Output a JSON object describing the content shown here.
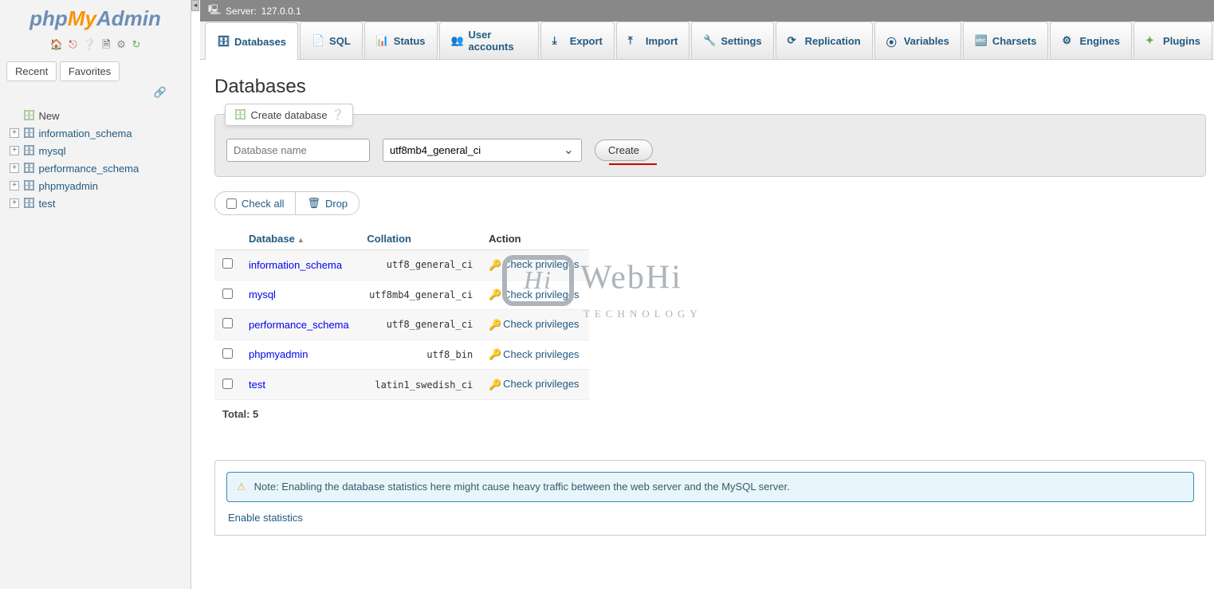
{
  "logo": {
    "php": "php",
    "my": "My",
    "admin": "Admin"
  },
  "sidebar": {
    "tabs": {
      "recent": "Recent",
      "favorites": "Favorites"
    },
    "new_label": "New",
    "databases": [
      "information_schema",
      "mysql",
      "performance_schema",
      "phpmyadmin",
      "test"
    ]
  },
  "serverinfo": {
    "label": "Server:",
    "host": "127.0.0.1"
  },
  "tabs": [
    {
      "label": "Databases",
      "active": true
    },
    {
      "label": "SQL"
    },
    {
      "label": "Status"
    },
    {
      "label": "User accounts"
    },
    {
      "label": "Export"
    },
    {
      "label": "Import"
    },
    {
      "label": "Settings"
    },
    {
      "label": "Replication"
    },
    {
      "label": "Variables"
    },
    {
      "label": "Charsets"
    },
    {
      "label": "Engines"
    },
    {
      "label": "Plugins"
    }
  ],
  "page": {
    "title": "Databases"
  },
  "create": {
    "legend": "Create database",
    "placeholder": "Database name",
    "collation": "utf8mb4_general_ci",
    "button": "Create"
  },
  "bulk": {
    "check_all": "Check all",
    "drop": "Drop"
  },
  "table": {
    "headers": {
      "database": "Database",
      "collation": "Collation",
      "action": "Action"
    },
    "priv_label": "Check privileges",
    "rows": [
      {
        "name": "information_schema",
        "collation": "utf8_general_ci"
      },
      {
        "name": "mysql",
        "collation": "utf8mb4_general_ci"
      },
      {
        "name": "performance_schema",
        "collation": "utf8_general_ci"
      },
      {
        "name": "phpmyadmin",
        "collation": "utf8_bin"
      },
      {
        "name": "test",
        "collation": "latin1_swedish_ci"
      }
    ],
    "total_label": "Total:",
    "total_count": "5"
  },
  "notice": {
    "text": "Note: Enabling the database statistics here might cause heavy traffic between the web server and the MySQL server.",
    "enable": "Enable statistics"
  },
  "watermark": {
    "top": "WebHi",
    "sub": "TECHNOLOGY",
    "box": "Hi"
  }
}
